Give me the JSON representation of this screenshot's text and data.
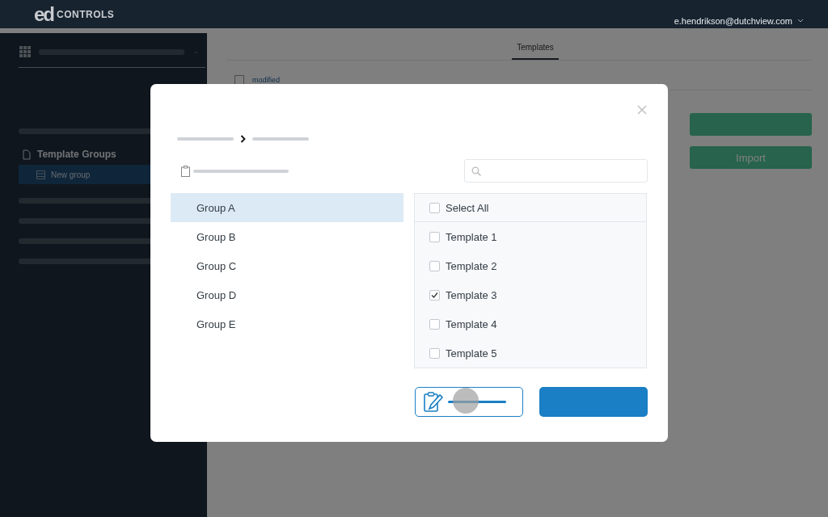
{
  "header": {
    "logo_mark": "ed",
    "logo_text": "CONTROLS",
    "user": "e.hendrikson@dutchview.com"
  },
  "sidebar": {
    "section": {
      "label": "Template Groups",
      "children": [
        {
          "label": "New group",
          "selected": true
        }
      ]
    }
  },
  "main": {
    "tabs": [
      {
        "label": "Templates",
        "selected": true
      }
    ],
    "sort": {
      "checked": false,
      "field": "modified"
    },
    "buttons": [
      {
        "kind": "blank"
      },
      {
        "kind": "labeled",
        "label": "Import"
      }
    ]
  },
  "dialog": {
    "groups": [
      {
        "label": "Group A",
        "selected": true
      },
      {
        "label": "Group B",
        "selected": false
      },
      {
        "label": "Group C",
        "selected": false
      },
      {
        "label": "Group D",
        "selected": false
      },
      {
        "label": "Group E",
        "selected": false
      }
    ],
    "templates": [
      {
        "label": "Select All",
        "checked": false,
        "kind": "all"
      },
      {
        "label": "Template 1",
        "checked": false,
        "kind": "item"
      },
      {
        "label": "Template 2",
        "checked": false,
        "kind": "item"
      },
      {
        "label": "Template 3",
        "checked": true,
        "kind": "item"
      },
      {
        "label": "Template 4",
        "checked": false,
        "kind": "item"
      },
      {
        "label": "Template 5",
        "checked": false,
        "kind": "item"
      }
    ]
  }
}
